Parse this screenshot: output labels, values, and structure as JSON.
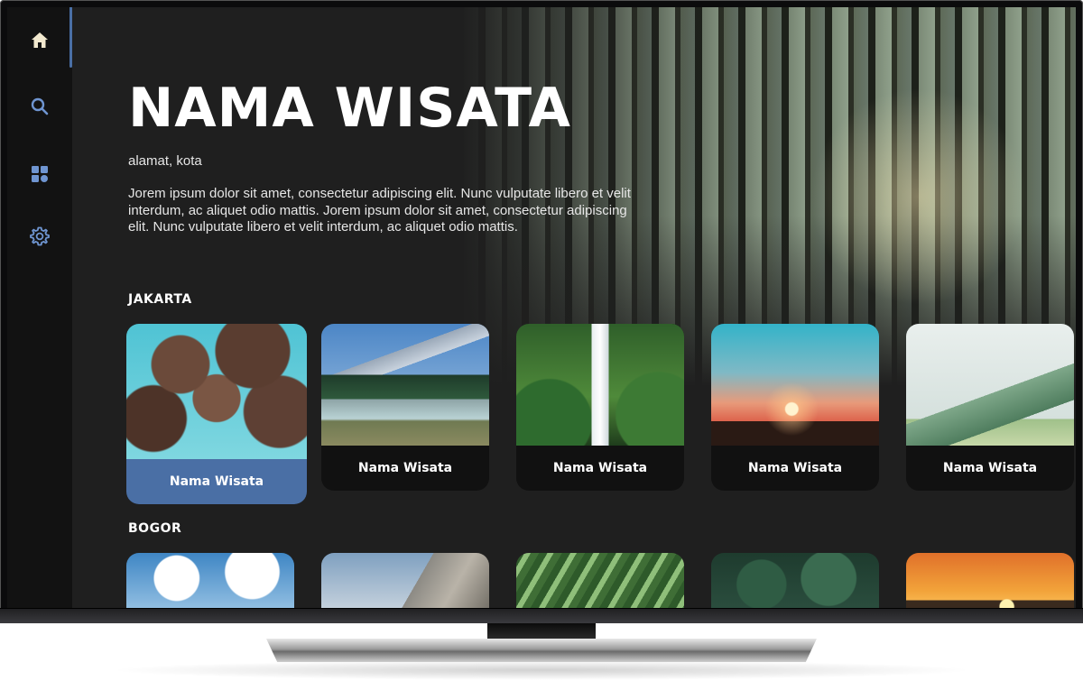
{
  "sidebar": {
    "items": [
      {
        "name": "home",
        "icon": "home-icon",
        "active": true
      },
      {
        "name": "search",
        "icon": "search-icon",
        "active": false
      },
      {
        "name": "categories",
        "icon": "grid-icon",
        "active": false
      },
      {
        "name": "settings",
        "icon": "gear-icon",
        "active": false
      }
    ]
  },
  "hero": {
    "title": "NAMA WISATA",
    "address": "alamat, kota",
    "description": "Jorem ipsum dolor sit amet, consectetur adipiscing elit. Nunc vulputate libero et velit interdum, ac aliquet odio mattis. Jorem ipsum dolor sit amet, consectetur adipiscing elit. Nunc vulputate libero et velit interdum, ac aliquet odio mattis."
  },
  "sections": [
    {
      "title": "JAKARTA",
      "cards": [
        {
          "label": "Nama Wisata",
          "focused": true
        },
        {
          "label": "Nama Wisata",
          "focused": false
        },
        {
          "label": "Nama Wisata",
          "focused": false
        },
        {
          "label": "Nama Wisata",
          "focused": false
        },
        {
          "label": "Nama Wisata",
          "focused": false
        }
      ]
    },
    {
      "title": "BOGOR"
    }
  ],
  "colors": {
    "accent": "#4a6fa5",
    "background": "#1f1f1f",
    "sidebar": "#121212"
  }
}
